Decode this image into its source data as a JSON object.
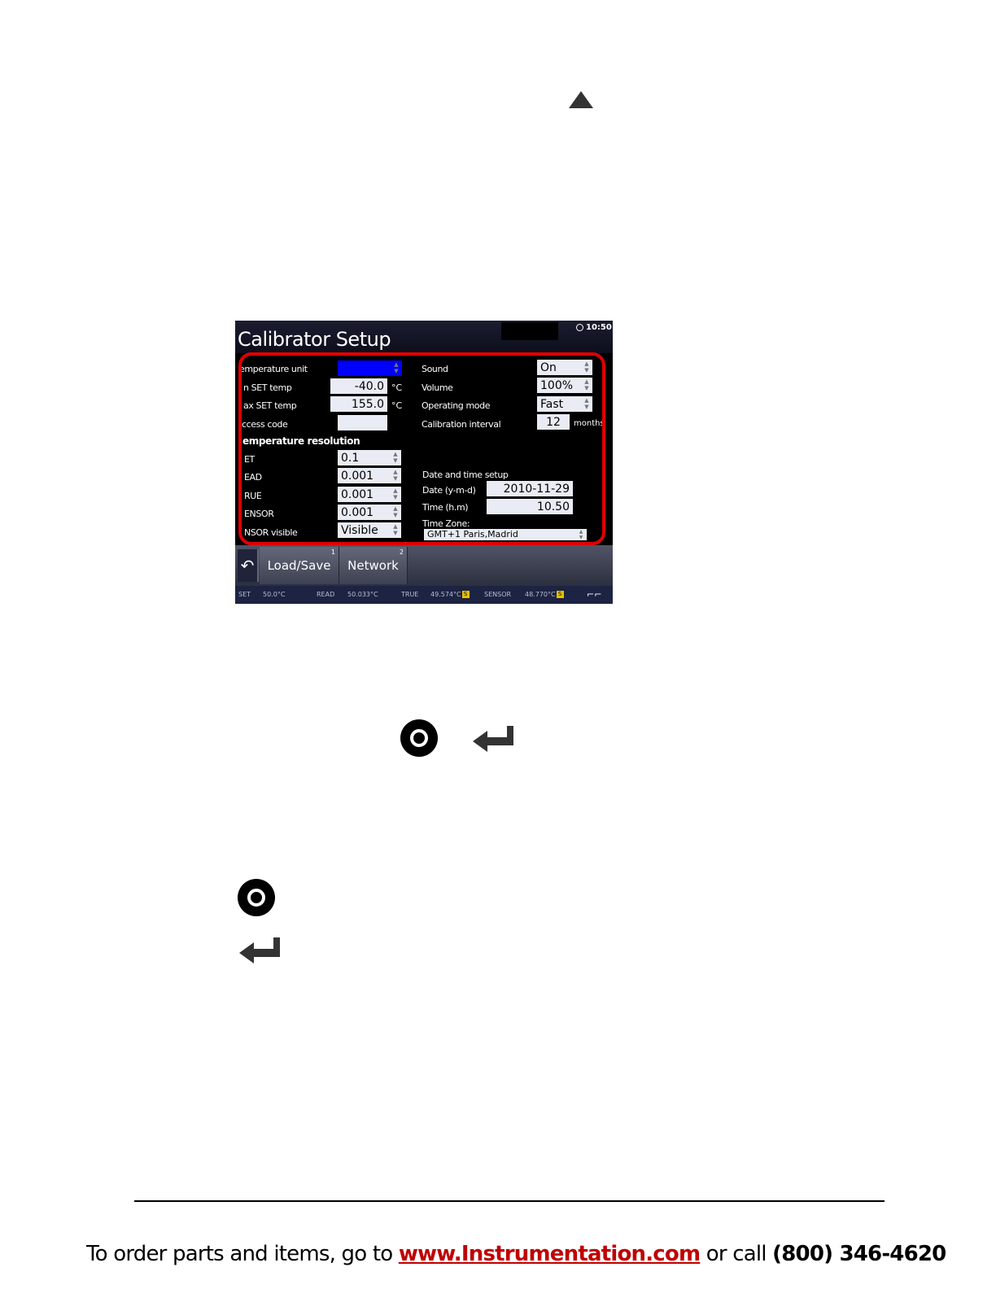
{
  "screen": {
    "title": "Calibrator Setup",
    "clock": "10:50",
    "left_fields": [
      {
        "label": "emperature unit",
        "value": ""
      },
      {
        "label": "n SET temp",
        "value": "-40.0",
        "unit": "°C"
      },
      {
        "label": "ax SET temp",
        "value": "155.0",
        "unit": "°C"
      },
      {
        "label": "ccess code",
        "value": ""
      }
    ],
    "resolution_heading": "emperature resolution",
    "resolution_fields": [
      {
        "label": "ET",
        "value": "0.1"
      },
      {
        "label": "EAD",
        "value": "0.001"
      },
      {
        "label": "RUE",
        "value": "0.001"
      },
      {
        "label": "ENSOR",
        "value": "0.001"
      },
      {
        "label": "NSOR visible",
        "value": "Visible"
      }
    ],
    "right_fields": [
      {
        "label": "Sound",
        "value": "On"
      },
      {
        "label": "Volume",
        "value": "100%"
      },
      {
        "label": "Operating mode",
        "value": "Fast"
      },
      {
        "label": "Calibration  interval",
        "value": "12",
        "unit": "months"
      }
    ],
    "datetime": {
      "heading": "Date and time setup",
      "date_label": "Date (y-m-d)",
      "date_value": "2010-11-29",
      "time_label": "Time (h.m)",
      "time_value": "10.50",
      "zone_label": "Time Zone:",
      "zone_value": "GMT+1 Paris,Madrid"
    },
    "softkeys": [
      {
        "label": "Load/Save",
        "number": "1"
      },
      {
        "label": "Network",
        "number": "2"
      }
    ],
    "status": {
      "set_label": "SET",
      "set_value": "50.0°C",
      "read_label": "READ",
      "read_value": "50.033°C",
      "true_label": "TRUE",
      "true_value": "49.574°C",
      "sensor_label": "SENSOR",
      "sensor_value": "48.770°C",
      "badge": "S"
    }
  },
  "footer": {
    "text_before": "To order parts and items, go to ",
    "link": "www.Instrumentation.com",
    "text_middle": " or call  ",
    "phone": "(800) 346-4620"
  },
  "icons": {
    "top": "triangle-up-icon",
    "row1": [
      "round-button-icon",
      "enter-key-icon"
    ],
    "stacked": [
      "round-button-icon",
      "enter-key-icon"
    ]
  }
}
